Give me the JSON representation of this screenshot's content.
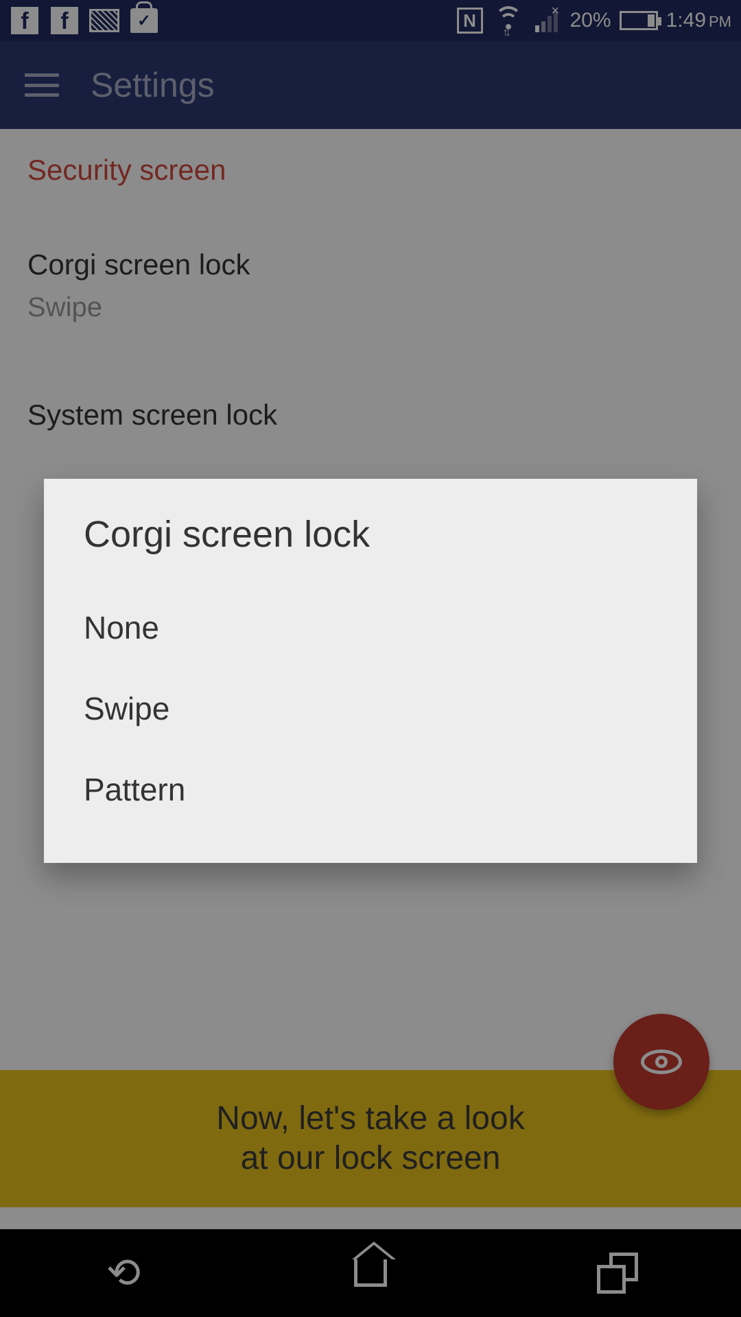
{
  "status": {
    "battery_pct": "20%",
    "time": "1:49",
    "ampm": "PM"
  },
  "appbar": {
    "title": "Settings"
  },
  "section": {
    "label": "Security screen"
  },
  "items": [
    {
      "title": "Corgi screen lock",
      "sub": "Swipe"
    },
    {
      "title": "System screen lock",
      "sub": ""
    }
  ],
  "cta": {
    "line1": "Now, let's take a look",
    "line2": "at our lock screen"
  },
  "dialog": {
    "title": "Corgi screen lock",
    "options": [
      "None",
      "Swipe",
      "Pattern"
    ]
  }
}
